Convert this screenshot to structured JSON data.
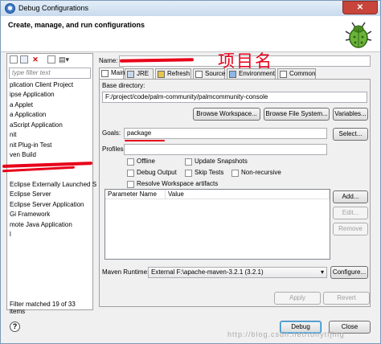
{
  "window": {
    "title": "Debug Configurations"
  },
  "header": {
    "text": "Create, manage, and run configurations"
  },
  "left": {
    "filter_placeholder": "type filter text",
    "items": [
      "plication Client Project",
      "ipse Application",
      "a Applet",
      "a Application",
      "aScript Application",
      "nit",
      "nit Plug-in Test",
      "ven Build",
      "Eclipse Externally Launched S",
      "Eclipse Server",
      "Eclipse Server Application",
      "Gi Framework",
      "mote Java Application"
    ],
    "status": "Filter matched 19 of 33 items"
  },
  "right": {
    "name_label": "Name:",
    "name_annotation": "项目名",
    "tabs": [
      "Main",
      "JRE",
      "Refresh",
      "Source",
      "Environment",
      "Common"
    ],
    "base_dir_label": "Base directory:",
    "base_dir_value": "F:/project/code/palm-community/palmcommunity-console",
    "browse_workspace": "Browse Workspace...",
    "browse_fs": "Browse File System...",
    "variables": "Variables...",
    "goals_label": "Goals:",
    "goals_value": "package",
    "select": "Select...",
    "profiles_label": "Profiles:",
    "offline": "Offline",
    "update_snapshots": "Update Snapshots",
    "debug_output": "Debug Output",
    "skip_tests": "Skip Tests",
    "non_recursive": "Non-recursive",
    "resolve_ws": "Resolve Workspace artifacts",
    "param_header": "Parameter Name",
    "value_header": "Value",
    "add": "Add...",
    "edit": "Edit...",
    "remove": "Remove",
    "runtime_label": "Maven Runtime:",
    "runtime_value": "External F:\\apache-maven-3.2.1 (3.2.1)",
    "configure": "Configure...",
    "apply": "Apply",
    "revert": "Revert"
  },
  "footer": {
    "help": "?",
    "debug": "Debug",
    "close": "Close",
    "watermark": "http://blog.csdn.net/tonytfjing"
  }
}
